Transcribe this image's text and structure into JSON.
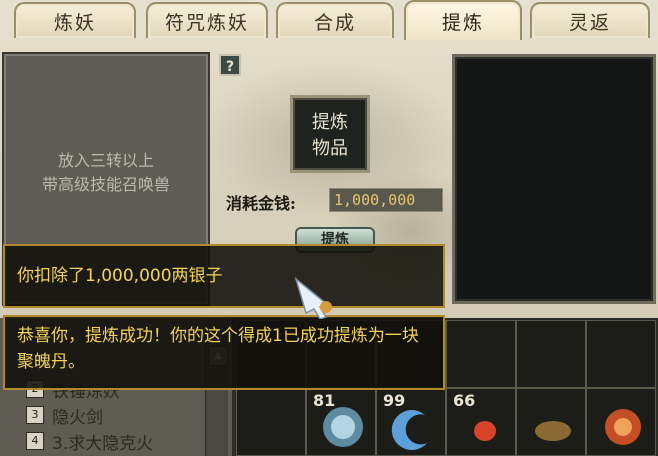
{
  "tabs": [
    {
      "label": "炼妖",
      "active": false
    },
    {
      "label": "符咒炼妖",
      "active": false
    },
    {
      "label": "合成",
      "active": false
    },
    {
      "label": "提炼",
      "active": true
    },
    {
      "label": "灵返",
      "active": false
    }
  ],
  "help": {
    "label": "?"
  },
  "left_box": {
    "hint": "放入三转以上\n带高级技能召唤兽"
  },
  "item_slot": {
    "label": "提炼\n物品"
  },
  "cost": {
    "label": "消耗金钱:",
    "value": "1,000,000"
  },
  "refine_button": {
    "label": "提炼"
  },
  "messages": [
    {
      "text": "你扣除了1,000,000两银子"
    },
    {
      "text": "恭喜你，提炼成功！你的这个得成1已成功提炼为一块聚魄丹。"
    }
  ],
  "list": {
    "items": [
      {
        "num": "2",
        "label": "铁锤炼妖"
      },
      {
        "num": "3",
        "label": "隐火剑"
      },
      {
        "num": "4",
        "label": "3.求大隐克火"
      }
    ]
  },
  "inventory": {
    "counts": [
      "81",
      "99",
      "66"
    ]
  },
  "colors": {
    "gold_text": "#f3d35a",
    "gold_border": "#b18b2a",
    "cost_value": "#e6c66b"
  }
}
